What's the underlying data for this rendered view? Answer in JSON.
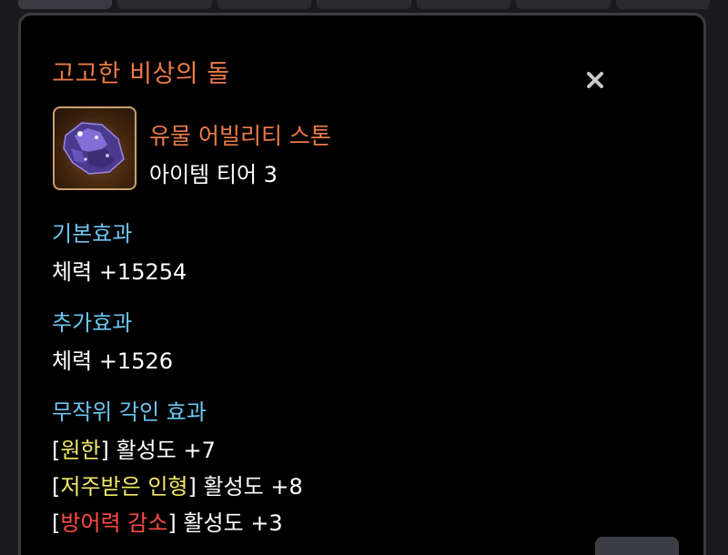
{
  "item": {
    "name": "고고한 비상의 돌",
    "grade_type": "유물 어빌리티 스톤",
    "tier": "아이템 티어 3"
  },
  "basic_effect": {
    "title": "기본효과",
    "stat_name": "체력",
    "stat_value": "+15254"
  },
  "additional_effect": {
    "title": "추가효과",
    "stat_name": "체력",
    "stat_value": "+1526"
  },
  "random_engravings": {
    "title": "무작위 각인 효과",
    "activity_label": "활성도",
    "items": [
      {
        "name": "원한",
        "value": "+7",
        "type": "positive"
      },
      {
        "name": "저주받은 인형",
        "value": "+8",
        "type": "positive"
      },
      {
        "name": "방어력 감소",
        "value": "+3",
        "type": "negative"
      }
    ]
  },
  "colors": {
    "item_name": "#ea7a48",
    "section_title": "#6cc6f2",
    "engraving_positive": "#f2e86a",
    "engraving_negative": "#ff4a44",
    "panel_border": "#3c3d42"
  },
  "icons": {
    "close": "close-icon",
    "item": "ability-stone-icon"
  }
}
